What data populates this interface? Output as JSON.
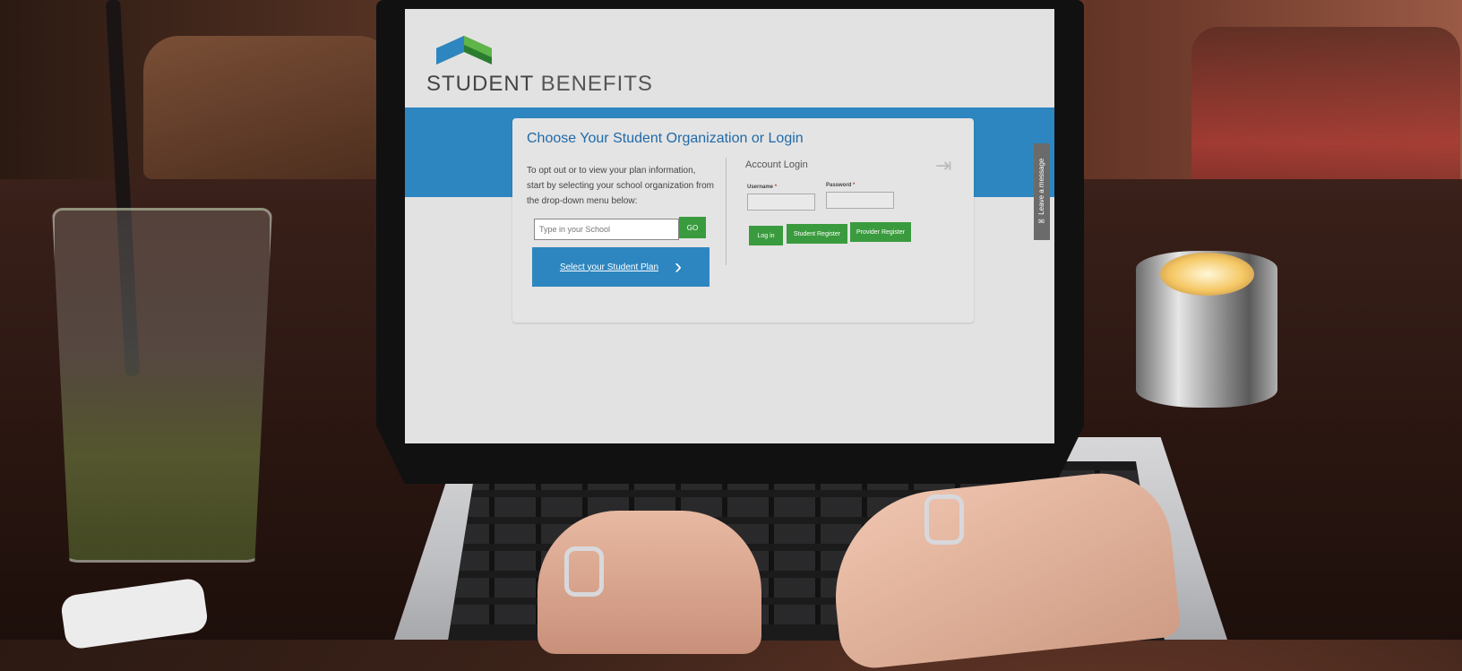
{
  "site": {
    "logo_word1": "STUDENT",
    "logo_word2": "BENEFITS",
    "brand_colors": {
      "blue": "#2d86c0",
      "green": "#3a9b3e",
      "dark_green": "#2a7d2f"
    }
  },
  "card": {
    "title": "Choose Your Student Organization or Login",
    "intro": "To opt out or to view your plan information, start by selecting your school organization from the drop-down menu below:",
    "school_placeholder": "Type in your School",
    "go_label": "GO",
    "plan_button_label": "Select your Student Plan",
    "plan_button_icon": "chevron-right-icon"
  },
  "login": {
    "title": "Account Login",
    "username_label": "Username",
    "password_label": "Password",
    "required_marker": "*",
    "login_button": "Log in",
    "student_register": "Student Register",
    "provider_register": "Provider Register",
    "icon": "sign-in-icon"
  },
  "side_tab": {
    "label": "Leave a message",
    "icon": "envelope-icon"
  }
}
